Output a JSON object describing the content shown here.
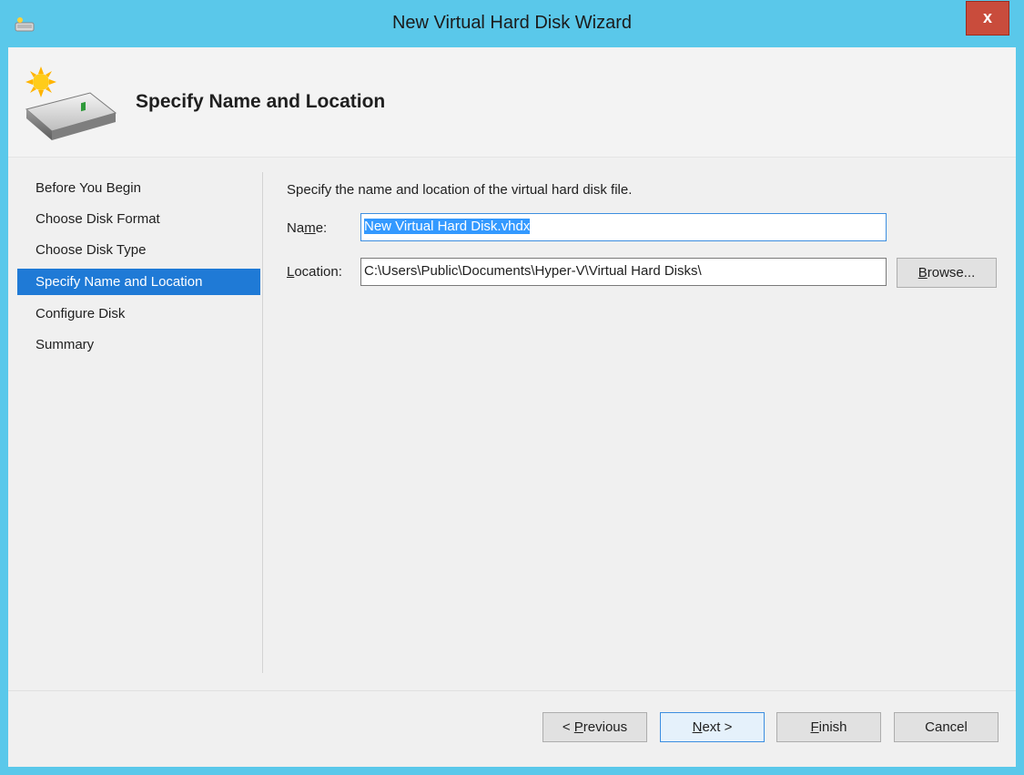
{
  "window": {
    "title": "New Virtual Hard Disk Wizard",
    "close_label": "x"
  },
  "header": {
    "title": "Specify Name and Location",
    "icon": "hard-disk-new-icon"
  },
  "nav": {
    "items": [
      {
        "label": "Before You Begin",
        "selected": false
      },
      {
        "label": "Choose Disk Format",
        "selected": false
      },
      {
        "label": "Choose Disk Type",
        "selected": false
      },
      {
        "label": "Specify Name and Location",
        "selected": true
      },
      {
        "label": "Configure Disk",
        "selected": false
      },
      {
        "label": "Summary",
        "selected": false
      }
    ]
  },
  "content": {
    "description": "Specify the name and location of the virtual hard disk file.",
    "name_label_pre": "Na",
    "name_label_accel": "m",
    "name_label_post": "e:",
    "name_value": "New Virtual Hard Disk.vhdx",
    "location_label_accel": "L",
    "location_label_post": "ocation:",
    "location_value": "C:\\Users\\Public\\Documents\\Hyper-V\\Virtual Hard Disks\\",
    "browse_accel": "B",
    "browse_post": "rowse..."
  },
  "footer": {
    "previous_pre": "< ",
    "previous_accel": "P",
    "previous_post": "revious",
    "next_accel": "N",
    "next_post": "ext >",
    "finish_accel": "F",
    "finish_post": "inish",
    "cancel_label": "Cancel"
  },
  "colors": {
    "titlebar": "#5ac8ea",
    "selection": "#1f7ad6",
    "close": "#c94c3c"
  }
}
